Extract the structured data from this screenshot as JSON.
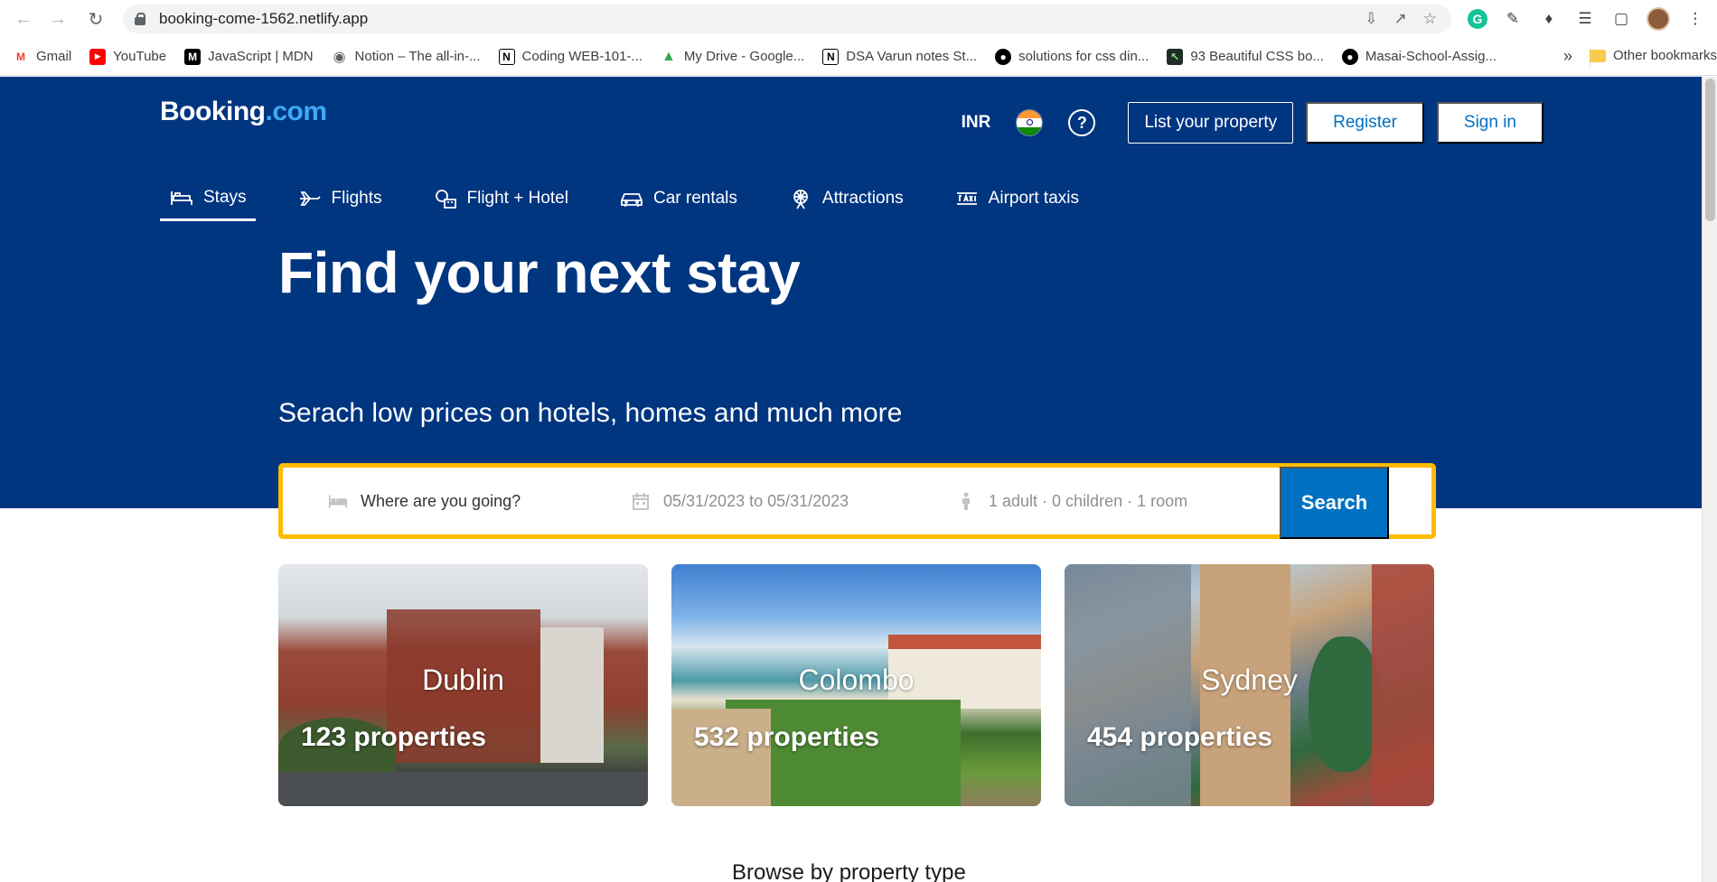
{
  "browser": {
    "url": "booking-come-1562.netlify.app",
    "bookmarks": [
      {
        "label": "Gmail",
        "icon": "gmail-icon"
      },
      {
        "label": "YouTube",
        "icon": "youtube-icon"
      },
      {
        "label": "JavaScript | MDN",
        "icon": "mdn-icon"
      },
      {
        "label": "Notion – The all-in-...",
        "icon": "notion-icon"
      },
      {
        "label": "Coding WEB-101-...",
        "icon": "notion-icon"
      },
      {
        "label": "My Drive - Google...",
        "icon": "google-drive-icon"
      },
      {
        "label": "DSA Varun notes St...",
        "icon": "notion-icon"
      },
      {
        "label": "solutions for css din...",
        "icon": "github-icon"
      },
      {
        "label": "93 Beautiful CSS bo...",
        "icon": "cursor-icon"
      },
      {
        "label": "Masai-School-Assig...",
        "icon": "github-icon"
      }
    ],
    "bookmarks_more": "»",
    "other_bookmarks": "Other bookmarks"
  },
  "header": {
    "logo_main": "Booking",
    "logo_suffix": ".com",
    "currency": "INR",
    "help": "?",
    "list_property": "List your property",
    "register": "Register",
    "sign_in": "Sign in"
  },
  "tabs": [
    {
      "label": "Stays",
      "icon": "bed-icon",
      "active": true
    },
    {
      "label": "Flights",
      "icon": "plane-icon"
    },
    {
      "label": "Flight + Hotel",
      "icon": "flight-hotel-icon"
    },
    {
      "label": "Car rentals",
      "icon": "car-icon"
    },
    {
      "label": "Attractions",
      "icon": "ferris-wheel-icon"
    },
    {
      "label": "Airport taxis",
      "icon": "taxi-icon"
    }
  ],
  "hero": {
    "title": "Find your next stay",
    "subtitle": "Serach low prices on hotels, homes and much more"
  },
  "search": {
    "destination_placeholder": "Where are you going?",
    "dates": "05/31/2023 to 05/31/2023",
    "guests": "1 adult · 0 children · 1 room",
    "button": "Search"
  },
  "destinations": [
    {
      "city": "Dublin",
      "count": "123 properties"
    },
    {
      "city": "Colombo",
      "count": "532 properties"
    },
    {
      "city": "Sydney",
      "count": "454 properties"
    }
  ],
  "browse_heading": "Browse by property type",
  "colors": {
    "brand_blue": "#003580",
    "accent_blue": "#0071c2",
    "search_border": "#febb02"
  }
}
